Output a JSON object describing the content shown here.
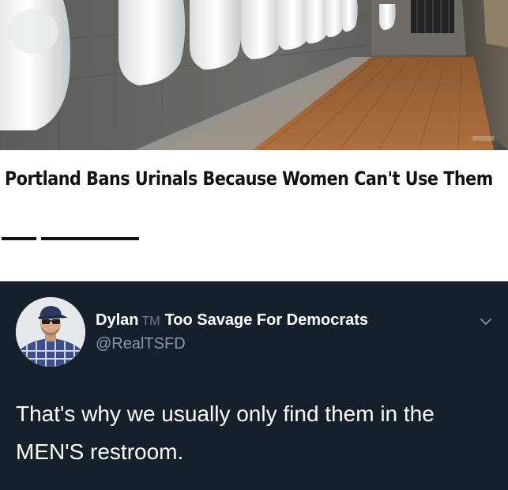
{
  "article": {
    "headline": "Portland Bans Urinals Because Women Can't Use Them"
  },
  "tweet": {
    "display_name": "Dylan",
    "trademark": "TM",
    "display_name_suffix": "Too Savage For Democrats",
    "handle": "@RealTSFD",
    "text": "That's why we usually only find them in the MEN'S restroom."
  },
  "icons": {
    "menu": "chevron-down-icon",
    "avatar": "avatar"
  },
  "colors": {
    "tweet_background": "#15202b",
    "handle": "#8899a6",
    "trademark": "#6e7d8b",
    "headline": "#111111"
  }
}
